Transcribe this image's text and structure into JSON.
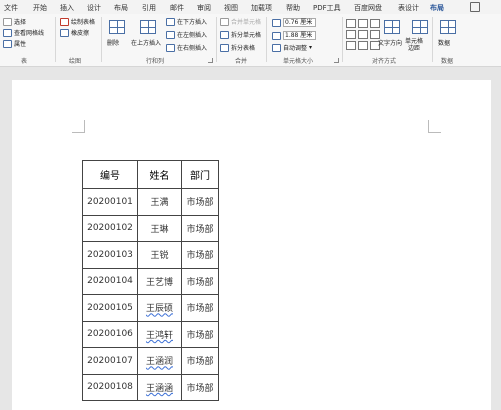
{
  "tabs": [
    "文件",
    "开始",
    "插入",
    "设计",
    "布局",
    "引用",
    "邮件",
    "审阅",
    "视图",
    "加载项",
    "帮助",
    "PDF工具",
    "百度网盘",
    "表设计",
    "布局"
  ],
  "ribbon": {
    "table_group": {
      "label": "表",
      "items": [
        "选择",
        "查看网格线",
        "属性"
      ]
    },
    "draw_group": {
      "label": "绘图",
      "items": [
        "绘制表格",
        "橡皮擦"
      ]
    },
    "rows_cols_group": {
      "label": "行和列",
      "delete": "删除",
      "insert_above": "在上方插入",
      "insert_below": "在下方插入",
      "insert_left": "在左侧插入",
      "insert_right": "在右侧插入"
    },
    "merge_group": {
      "label": "合并",
      "items": [
        "合并单元格",
        "拆分单元格",
        "拆分表格"
      ]
    },
    "cell_size_group": {
      "label": "单元格大小",
      "height": "0.76 厘米",
      "width": "1.88 厘米",
      "autofit": "自动调整"
    },
    "align_group": {
      "label": "对齐方式",
      "text_direction": "文字方向",
      "cell_margins": "单元格\n边距"
    },
    "data_group": {
      "label": "数据"
    }
  },
  "table": {
    "headers": [
      "编号",
      "姓名",
      "部门"
    ],
    "rows": [
      [
        "20200101",
        "王满",
        "市场部"
      ],
      [
        "20200102",
        "王琳",
        "市场部"
      ],
      [
        "20200103",
        "王锐",
        "市场部"
      ],
      [
        "20200104",
        "王艺博",
        "市场部"
      ],
      [
        "20200105",
        "王辰硕",
        "市场部"
      ],
      [
        "20200106",
        "王鸿轩",
        "市场部"
      ],
      [
        "20200107",
        "王涵润",
        "市场部"
      ],
      [
        "20200108",
        "王涵涵",
        "市场部"
      ]
    ]
  }
}
